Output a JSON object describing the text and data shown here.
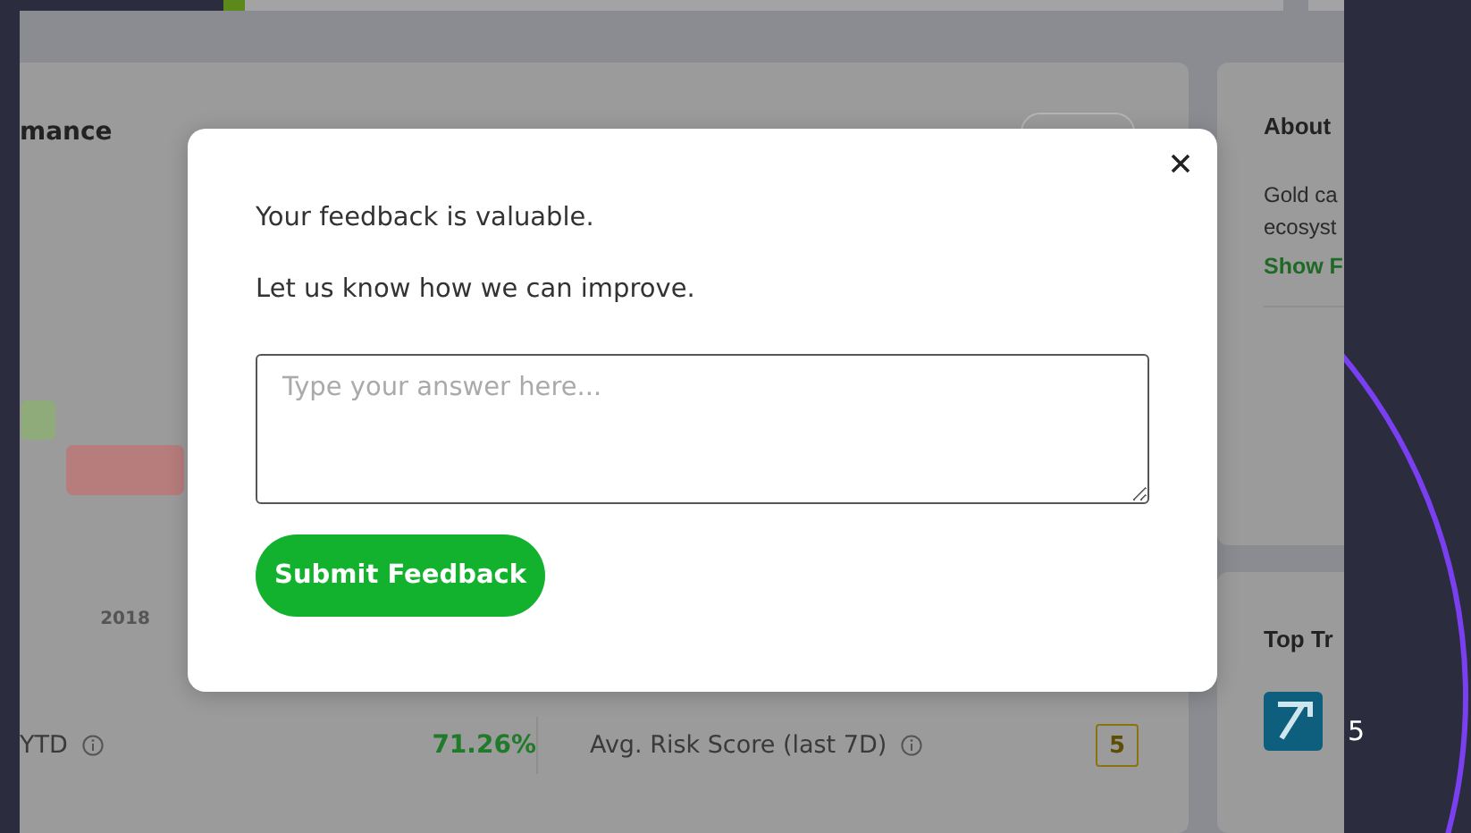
{
  "performance_card": {
    "title": "mance",
    "chart_label": "2018",
    "stat": {
      "label": "YTD",
      "value": "71.26%"
    },
    "risk": {
      "label": "Avg. Risk Score (last 7D)",
      "value": "5"
    }
  },
  "about_card": {
    "title": "About",
    "lines": [
      "Gold ca",
      "ecosyst"
    ],
    "link": "Show F"
  },
  "top_card": {
    "title": "Top Tr"
  },
  "side_panel": {
    "text": "5"
  },
  "modal": {
    "lines": [
      "Your feedback is valuable.",
      "Let us know how we can improve."
    ],
    "answer": {
      "placeholder": "Type your answer here..."
    },
    "submit": "Submit Feedback"
  }
}
